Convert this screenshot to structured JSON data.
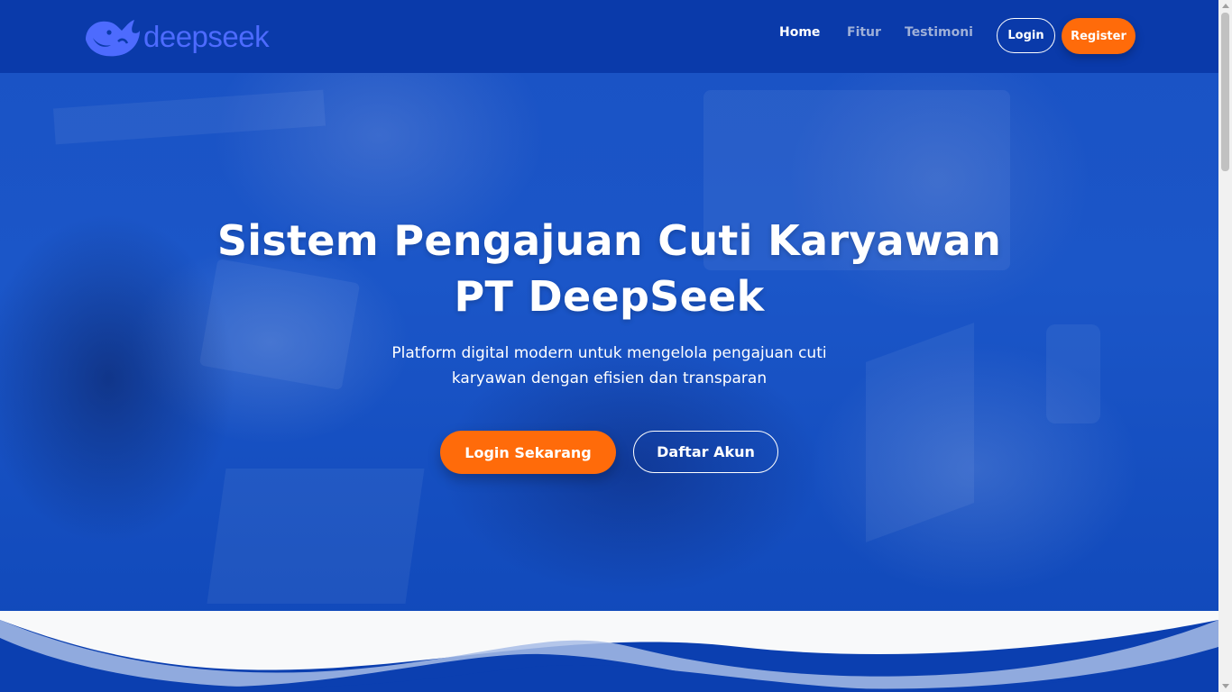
{
  "brand": {
    "name": "deepseek",
    "logo_icon": "whale-icon",
    "color": "#4d6bfe"
  },
  "nav": {
    "links": [
      {
        "label": "Home",
        "active": true
      },
      {
        "label": "Fitur",
        "active": false
      },
      {
        "label": "Testimoni",
        "active": false
      }
    ],
    "login_label": "Login",
    "register_label": "Register"
  },
  "hero": {
    "title_line1": "Sistem Pengajuan Cuti Karyawan",
    "title_line2": "PT DeepSeek",
    "subtitle_line1": "Platform digital modern untuk mengelola pengajuan cuti",
    "subtitle_line2": "karyawan dengan efisien dan transparan",
    "primary_button": "Login Sekarang",
    "secondary_button": "Daftar Akun"
  },
  "colors": {
    "navbar_bg": "#0a3aaa",
    "hero_overlay": "#1b56c8",
    "accent_orange": "#ff6b0a",
    "wave_light": "#f8f9fa"
  }
}
